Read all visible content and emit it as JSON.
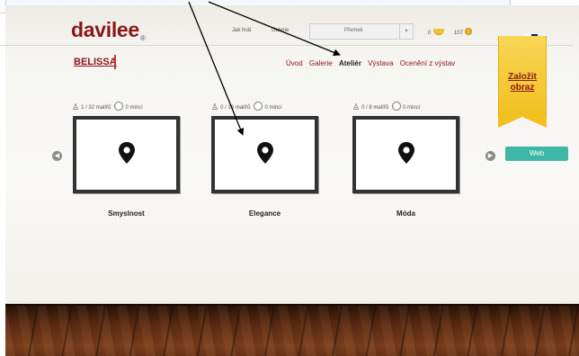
{
  "header": {
    "logo": "davilee",
    "logo_mark": "®",
    "how_to_play": "Jak hrát",
    "nav_partial": "Galerie",
    "user_name": "Přemek",
    "bananas": "0",
    "coins": "107",
    "languages": [
      "cz",
      "en"
    ]
  },
  "gallery": {
    "name": "BELISSA",
    "nav": [
      {
        "label": "Úvod",
        "active": false
      },
      {
        "label": "Galerie",
        "active": false
      },
      {
        "label": "Ateliér",
        "active": true
      },
      {
        "label": "Výstava",
        "active": false
      },
      {
        "label": "Ocenění z výstav",
        "active": false
      }
    ]
  },
  "sidebar": {
    "create_label_line1": "Založit",
    "create_label_line2": "obraz",
    "web_button": "Web"
  },
  "cards": [
    {
      "painters": "1 / 32 malířů",
      "coins": "0 mincí",
      "title": "Smysl­nost"
    },
    {
      "painters": "0 / 16 malířů",
      "coins": "0 mincí",
      "title": "Elegance"
    },
    {
      "painters": "0 / 8 malířů",
      "coins": "0 mincí",
      "title": "Móda"
    }
  ],
  "colors": {
    "brand": "#8a1717",
    "ribbon": "#f2c01f",
    "web_button": "#3fb7a6",
    "frame": "#333333",
    "floor": "#5a2a12"
  },
  "icons": {
    "prev": "left-arrow-icon",
    "next": "right-arrow-icon",
    "location": "location-pin-icon",
    "painter": "painter-icon",
    "coin": "coin-icon"
  }
}
